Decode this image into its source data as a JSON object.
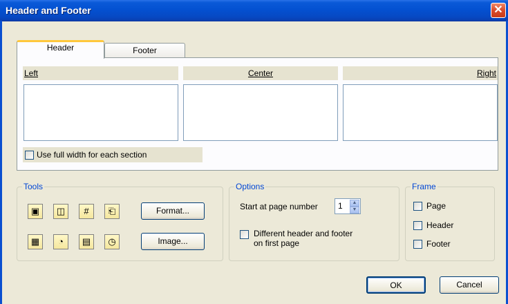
{
  "window": {
    "title": "Header and Footer",
    "close_glyph": "✕"
  },
  "tabs": [
    {
      "label": "Header",
      "active": true
    },
    {
      "label": "Footer",
      "active": false
    }
  ],
  "columns": {
    "left": {
      "label": "Left",
      "value": ""
    },
    "center": {
      "label": "Center",
      "value": ""
    },
    "right": {
      "label": "Right",
      "value": ""
    }
  },
  "full_width": {
    "label": "Use full width for each section",
    "checked": false
  },
  "tools": {
    "label": "Tools",
    "icons": [
      {
        "name": "save-icon",
        "glyph": "▣"
      },
      {
        "name": "folder-icon",
        "glyph": "◫"
      },
      {
        "name": "page-number-icon",
        "glyph": "#"
      },
      {
        "name": "page-count-icon",
        "glyph": "⎗"
      },
      {
        "name": "date-icon",
        "glyph": "▦"
      },
      {
        "name": "time-icon",
        "glyph": "◔"
      },
      {
        "name": "calendar-icon",
        "glyph": "▤"
      },
      {
        "name": "clock-icon",
        "glyph": "◷"
      }
    ],
    "format_label": "Format...",
    "image_label": "Image..."
  },
  "options": {
    "label": "Options",
    "start_page_label": "Start at page number",
    "start_page_value": "1",
    "different_first_label_line1": "Different header and footer",
    "different_first_label_line2": "on first page",
    "different_first_checked": false
  },
  "frame": {
    "label": "Frame",
    "page": "Page",
    "header": "Header",
    "footer": "Footer"
  },
  "buttons": {
    "ok": "OK",
    "cancel": "Cancel"
  }
}
